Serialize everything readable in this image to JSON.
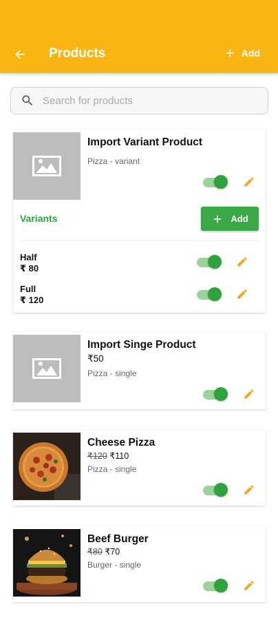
{
  "header": {
    "title": "Products",
    "add_label": "Add"
  },
  "search": {
    "placeholder": "Search for products"
  },
  "colors": {
    "accent": "#f9b514",
    "green": "#2fa33b",
    "edit": "#f5a623"
  },
  "products": [
    {
      "name": "Import Variant Product",
      "meta": "Pizza - variant",
      "enabled": true,
      "variants_label": "Variants",
      "add_variant_label": "Add",
      "variants": [
        {
          "name": "Half",
          "price": "₹ 80",
          "enabled": true
        },
        {
          "name": "Full",
          "price": "₹ 120",
          "enabled": true
        }
      ]
    },
    {
      "name": "Import Singe Product",
      "price": "₹50",
      "meta": "Pizza - single",
      "enabled": true
    },
    {
      "name": "Cheese Pizza",
      "old_price": "₹120",
      "price": "₹110",
      "meta": "Pizza - single",
      "enabled": true
    },
    {
      "name": "Beef Burger",
      "old_price": "₹80",
      "price": "₹70",
      "meta": "Burger - single",
      "enabled": true
    }
  ]
}
